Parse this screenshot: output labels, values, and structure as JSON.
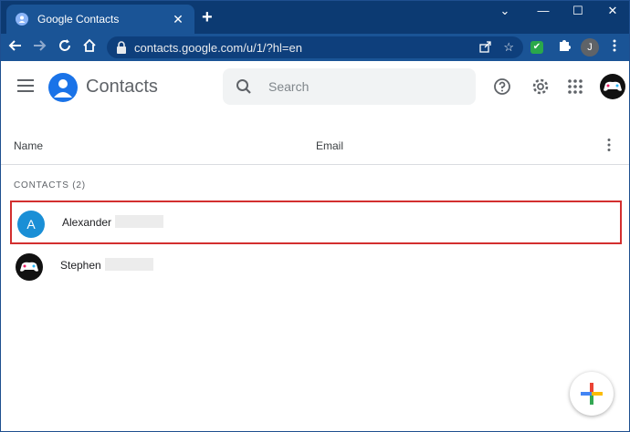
{
  "browser": {
    "tab_title": "Google Contacts",
    "tab_close": "✕",
    "new_tab": "+",
    "window_controls": [
      "⌄",
      "—",
      "☐",
      "✕"
    ],
    "url": "contacts.google.com/u/1/?hl=en",
    "profile_initial": "J",
    "extension_check": "✔"
  },
  "app": {
    "title": "Contacts",
    "search_placeholder": "Search"
  },
  "table": {
    "columns": [
      "Name",
      "Email"
    ],
    "section_label": "CONTACTS (2)",
    "rows": [
      {
        "initial": "A",
        "name": "Alexander",
        "avatar_color": "#1a8fd6",
        "selected": true
      },
      {
        "initial": "",
        "name": "Stephen",
        "avatar_color": "#111111",
        "selected": false
      }
    ]
  },
  "colors": {
    "browser_frame": "#0c3a72",
    "toolbar": "#1a5496",
    "accent": "#1a73e8",
    "highlight_border": "#d32f2f"
  }
}
